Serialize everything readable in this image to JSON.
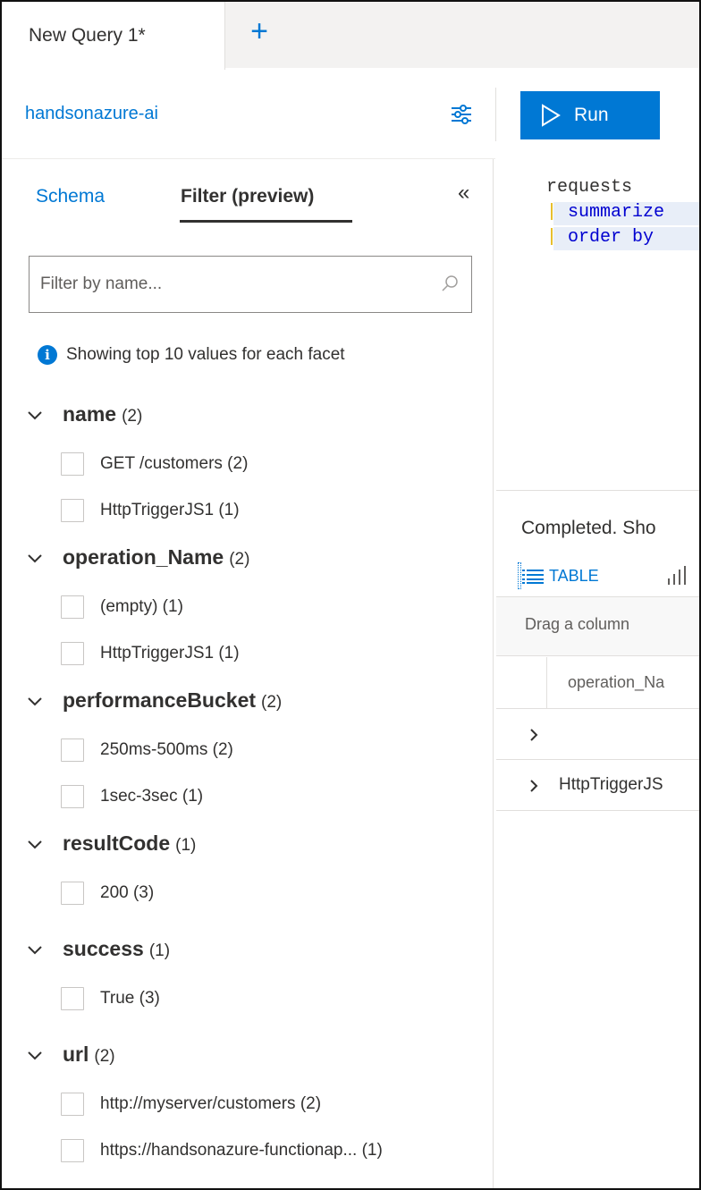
{
  "tabs": {
    "active_label": "New Query 1*",
    "add_label": "+"
  },
  "workspace": {
    "name": "handsonazure-ai"
  },
  "toolbar": {
    "run_label": "Run"
  },
  "panel": {
    "tabs": [
      "Schema",
      "Filter (preview)"
    ],
    "active_tab": "Filter (preview)",
    "collapse_glyph": "«",
    "filter_placeholder": "Filter by name...",
    "info_text": "Showing top 10 values for each facet"
  },
  "facets": [
    {
      "name": "name",
      "count": "(2)",
      "options": [
        "GET /customers (2)",
        "HttpTriggerJS1 (1)"
      ]
    },
    {
      "name": "operation_Name",
      "count": "(2)",
      "options": [
        "(empty) (1)",
        "HttpTriggerJS1 (1)"
      ]
    },
    {
      "name": "performanceBucket",
      "count": "(2)",
      "options": [
        "250ms-500ms (2)",
        "1sec-3sec (1)"
      ]
    },
    {
      "name": "resultCode",
      "count": "(1)",
      "options": [
        "200 (3)"
      ]
    },
    {
      "name": "success",
      "count": "(1)",
      "options": [
        "True (3)"
      ]
    },
    {
      "name": "url",
      "count": "(2)",
      "options": [
        "http://myserver/customers (2)",
        "https://handsonazure-functionap... (1)"
      ]
    }
  ],
  "editor": {
    "line1": "requests",
    "line2_pipe": "|",
    "line2_kw": " summarize",
    "line3_pipe": "|",
    "line3_kw": " order by"
  },
  "results": {
    "status": "Completed. Sho",
    "table_tab": "TABLE",
    "group_hint": "Drag a column",
    "column_header": "operation_Na",
    "rows": [
      "",
      "HttpTriggerJS"
    ]
  },
  "colors": {
    "accent": "#0078d4",
    "pipe": "#e2b100",
    "keyword": "#0000d0"
  }
}
